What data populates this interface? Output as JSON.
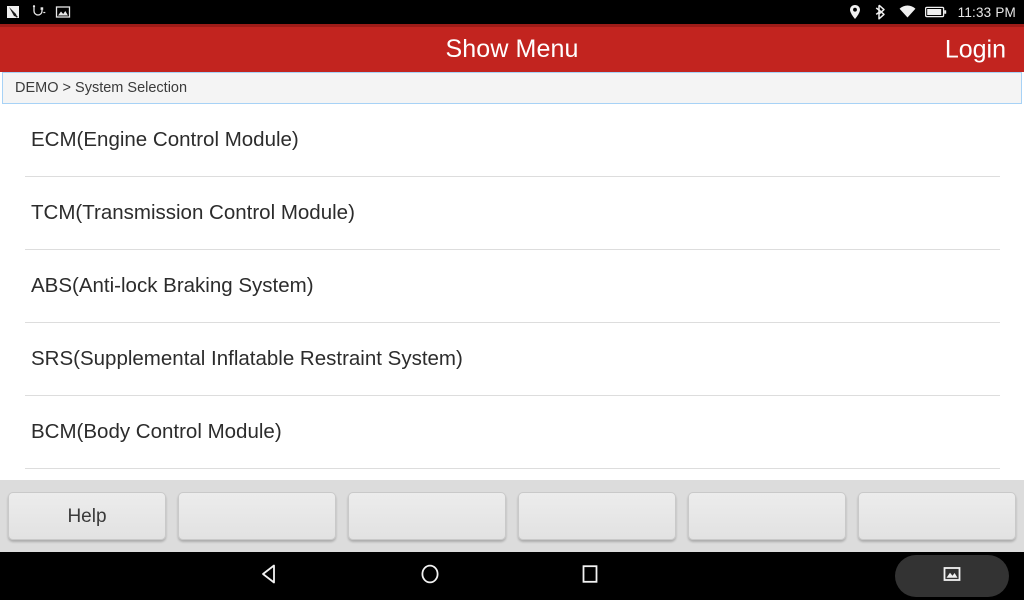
{
  "status_bar": {
    "left_icons": [
      "screenshot-capture-icon",
      "usb-diagnostic-icon",
      "image-gallery-icon"
    ],
    "right_icons": [
      "location-pin-icon",
      "bluetooth-icon",
      "wifi-icon",
      "battery-icon"
    ],
    "time": "11:33 PM"
  },
  "app_bar": {
    "title": "Show Menu",
    "action_label": "Login",
    "background_color": "#c2241f",
    "text_color": "#ffffff"
  },
  "breadcrumb": {
    "text": "DEMO > System Selection",
    "border_color": "#a7d2f6",
    "background_color": "#f4f4f4"
  },
  "menu": {
    "items": [
      {
        "label": "ECM(Engine Control Module)"
      },
      {
        "label": "TCM(Transmission Control Module)"
      },
      {
        "label": "ABS(Anti-lock Braking System)"
      },
      {
        "label": "SRS(Supplemental Inflatable Restraint System)"
      },
      {
        "label": "BCM(Body Control Module)"
      }
    ]
  },
  "tray": {
    "buttons": [
      {
        "label": "Help"
      },
      {
        "label": ""
      },
      {
        "label": ""
      },
      {
        "label": ""
      },
      {
        "label": ""
      },
      {
        "label": ""
      }
    ]
  },
  "nav_bar": {
    "back_icon": "back-triangle-icon",
    "home_icon": "home-circle-icon",
    "recents_icon": "recents-square-icon",
    "screenshot_icon": "screenshot-image-icon"
  }
}
